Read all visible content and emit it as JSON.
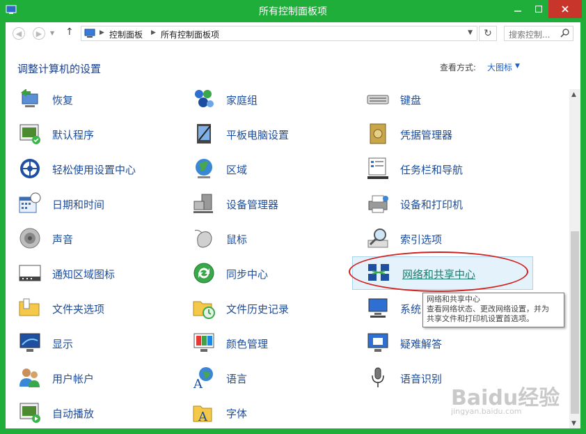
{
  "window": {
    "title": "所有控制面板项"
  },
  "nav": {
    "breadcrumb": [
      "控制面板",
      "所有控制面板项"
    ],
    "search_placeholder": "搜索控制..."
  },
  "header": {
    "title": "调整计算机的设置",
    "view_label": "查看方式:",
    "view_value": "大图标"
  },
  "items": [
    [
      "恢复",
      "家庭组",
      "键盘"
    ],
    [
      "默认程序",
      "平板电脑设置",
      "凭据管理器"
    ],
    [
      "轻松使用设置中心",
      "区域",
      "任务栏和导航"
    ],
    [
      "日期和时间",
      "设备管理器",
      "设备和打印机"
    ],
    [
      "声音",
      "鼠标",
      "索引选项"
    ],
    [
      "通知区域图标",
      "同步中心",
      "网络和共享中心"
    ],
    [
      "文件夹选项",
      "文件历史记录",
      "系统"
    ],
    [
      "显示",
      "颜色管理",
      "疑难解答"
    ],
    [
      "用户帐户",
      "语言",
      "语音识别"
    ],
    [
      "自动播放",
      "字体",
      ""
    ]
  ],
  "tooltip": {
    "title": "网络和共享中心",
    "line1": "查看网络状态、更改网络设置，并为",
    "line2": "共享文件和打印机设置首选项。"
  },
  "watermark": {
    "main": "Baidu经验",
    "sub": "jingyan.baidu.com"
  }
}
